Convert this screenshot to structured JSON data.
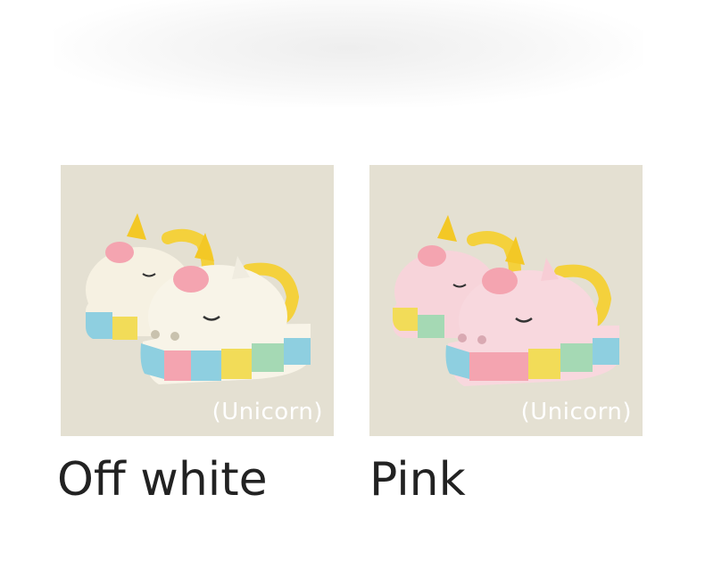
{
  "products": [
    {
      "color_name": "Off white",
      "variant_tag": "(Unicorn)",
      "shoe_color": "#f6f1e2",
      "sole_colors": [
        "#8ecfe0",
        "#f2dc58",
        "#f4a4b0",
        "#a5d9b4"
      ],
      "horn_color": "#f3c826",
      "strap_color": "#f4d13c"
    },
    {
      "color_name": "Pink",
      "variant_tag": "(Unicorn)",
      "shoe_color": "#f7d4da",
      "sole_colors": [
        "#8ecfe0",
        "#f2dc58",
        "#f4a4b0",
        "#a5d9b4"
      ],
      "horn_color": "#f3c826",
      "strap_color": "#f4d13c"
    }
  ]
}
